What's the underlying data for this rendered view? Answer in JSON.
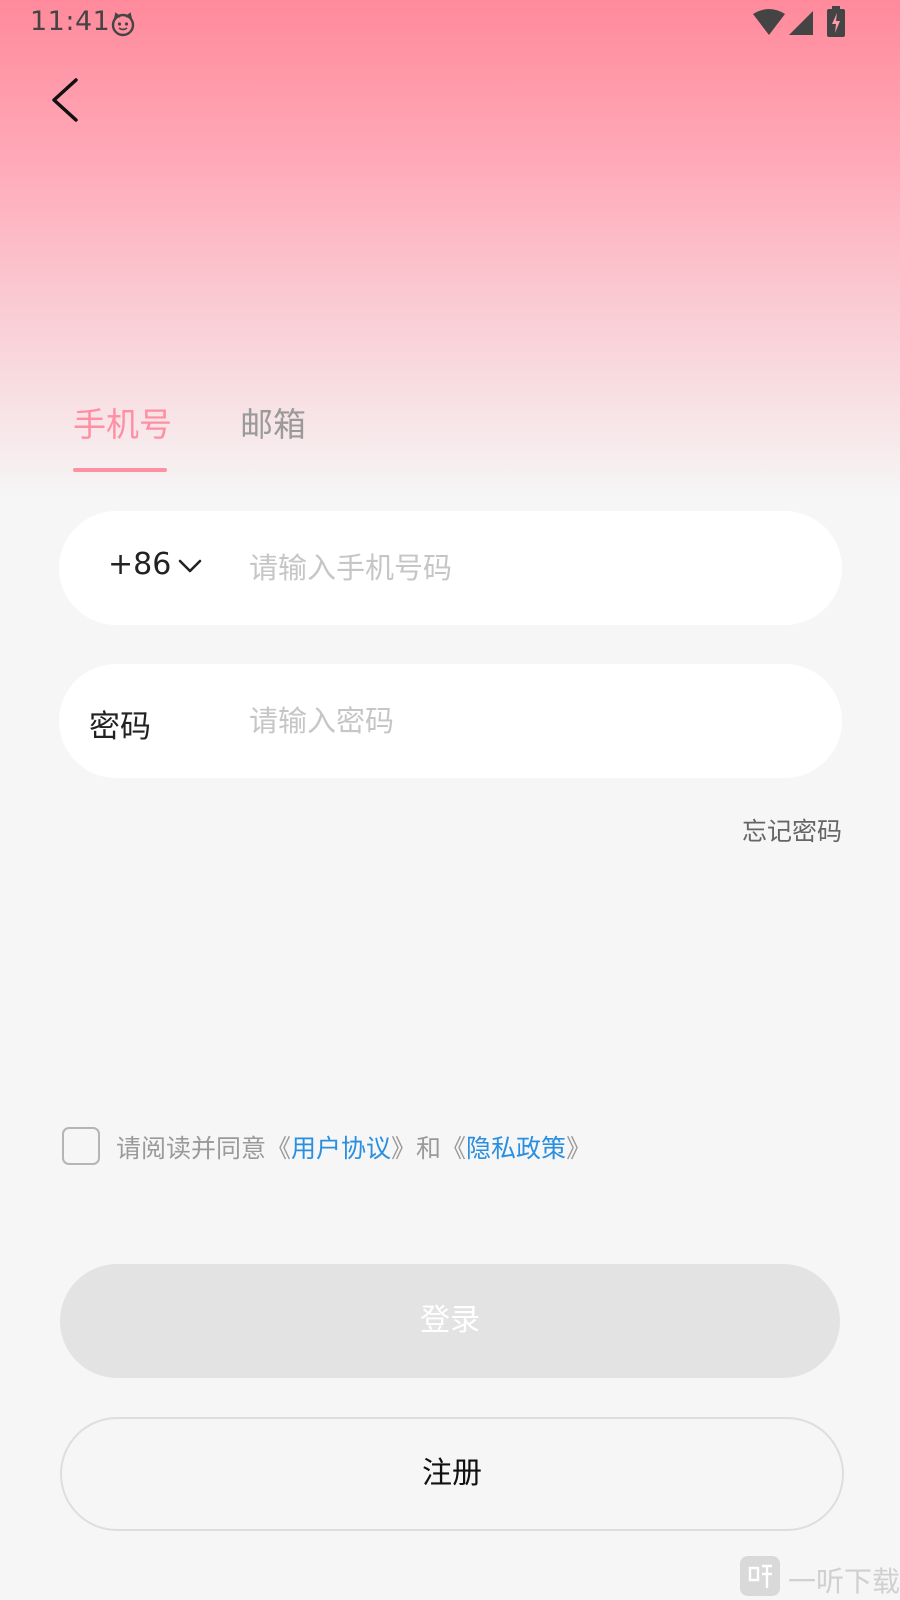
{
  "status_bar": {
    "time": "11:41",
    "icons": [
      "cat-face-icon",
      "wifi-icon",
      "signal-icon",
      "battery-charging-icon"
    ]
  },
  "nav": {
    "back_icon": "chevron-left-icon"
  },
  "tabs": [
    {
      "label": "手机号",
      "active": true
    },
    {
      "label": "邮箱",
      "active": false
    }
  ],
  "phone_field": {
    "country_code": "+86",
    "dropdown_icon": "chevron-down-icon",
    "value": "",
    "placeholder": "请输入手机号码"
  },
  "password_field": {
    "label": "密码",
    "value": "",
    "placeholder": "请输入密码"
  },
  "forgot_password": "忘记密码",
  "agreement": {
    "checked": false,
    "prefix": "请阅读并同意《",
    "user_agreement": "用户协议",
    "middle": "》和《",
    "privacy_policy": "隐私政策",
    "suffix": "》"
  },
  "buttons": {
    "login": "登录",
    "register": "注册"
  },
  "watermark": {
    "text": "一听下载"
  },
  "colors": {
    "accent": "#ff8fa3",
    "link": "#2a8fe0",
    "login_disabled_bg": "#e3e3e3",
    "background": "#f6f6f6"
  }
}
